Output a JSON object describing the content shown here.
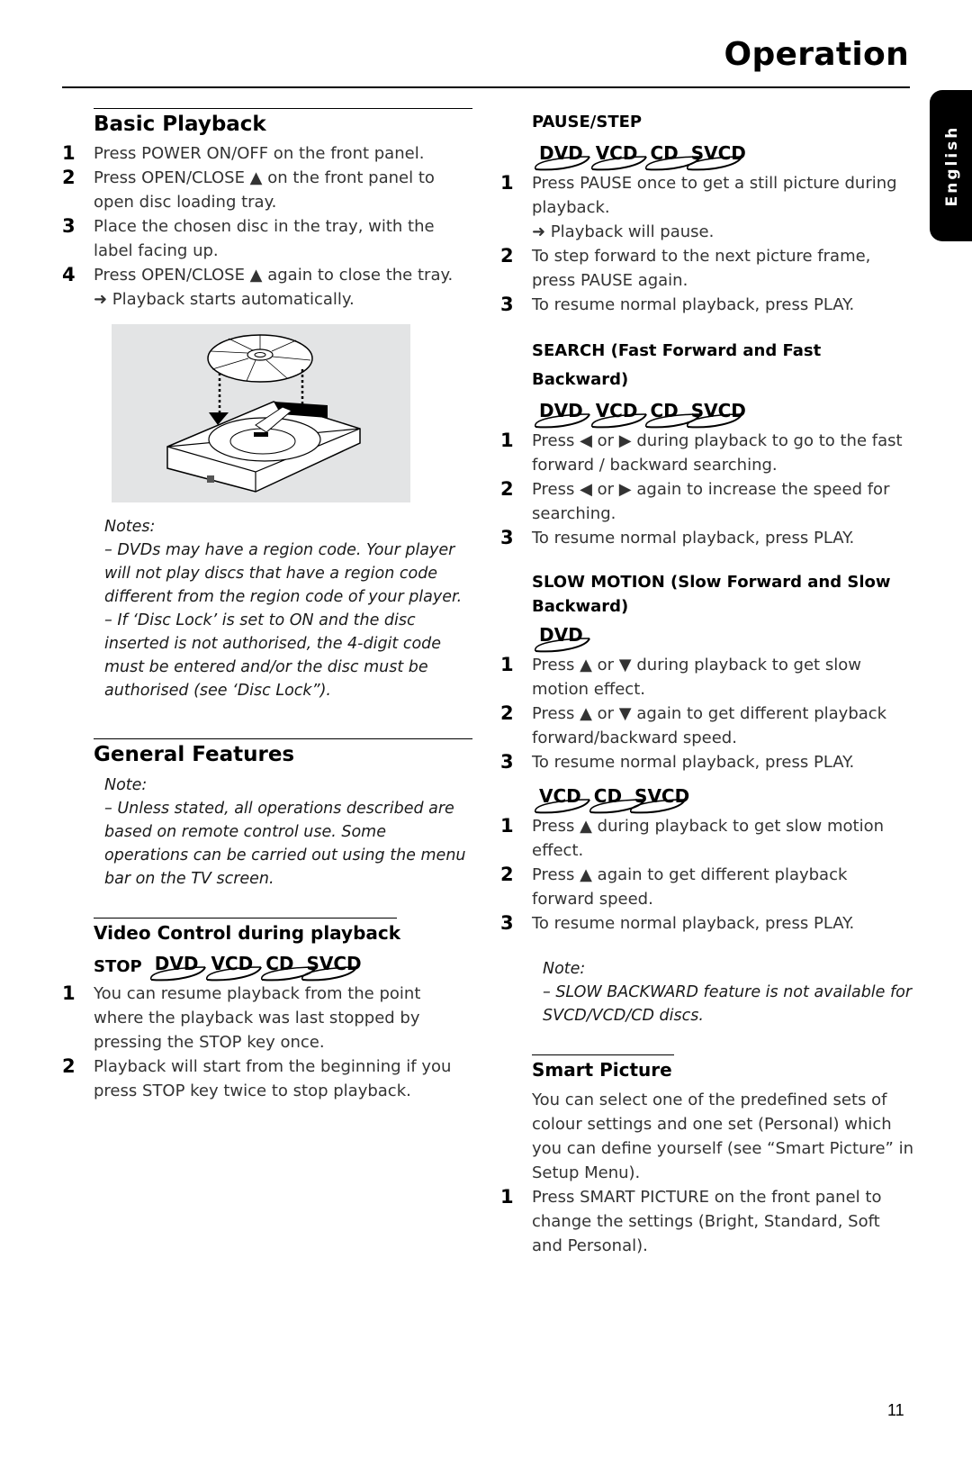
{
  "header": {
    "title": "Operation",
    "language_tab": "English"
  },
  "basic_playback": {
    "heading": "Basic Playback",
    "steps": [
      {
        "num": "1",
        "text": "Press POWER ON/OFF on the front panel."
      },
      {
        "num": "2",
        "text": "Press OPEN/CLOSE ▲ on the front panel to open disc loading tray."
      },
      {
        "num": "3",
        "text": "Place the chosen disc in the tray, with the label facing up."
      },
      {
        "num": "4",
        "text": "Press OPEN/CLOSE ▲ again to close the tray.",
        "result": "➜ Playback starts automatically."
      }
    ],
    "figure_alt": "disc-loading-tray-illustration",
    "notes": {
      "label": "Notes:",
      "items": [
        "–   DVDs may have a region code. Your player will not play discs that have a region code different from the region code of  your player.",
        "–   If ‘Disc Lock’ is set to ON and the disc inserted is not authorised, the 4-digit code must be entered and/or the disc must be authorised (see ‘Disc Lock”)."
      ]
    }
  },
  "general_features": {
    "heading": "General Features",
    "note": {
      "label": "Note:",
      "text": "–   Unless stated, all operations described are based on remote control use. Some operations can be carried out using the menu bar on the TV screen."
    }
  },
  "video_control": {
    "heading": "Video Control during playback",
    "stop": {
      "label": "STOP",
      "discs": [
        "DVD",
        "VCD",
        "CD",
        "SVCD"
      ],
      "steps": [
        {
          "num": "1",
          "text": "You can resume playback from the point where the playback was last stopped by pressing the STOP key once."
        },
        {
          "num": "2",
          "text": "Playback will start from the beginning if you press STOP key twice to stop playback."
        }
      ]
    }
  },
  "pause_step": {
    "label": "PAUSE/STEP",
    "discs": [
      "DVD",
      "VCD",
      "CD",
      "SVCD"
    ],
    "steps": [
      {
        "num": "1",
        "text": "Press PAUSE once to get a still picture during playback.",
        "result": "➜ Playback will pause."
      },
      {
        "num": "2",
        "text": "To step forward to the next picture frame, press PAUSE again."
      },
      {
        "num": "3",
        "text": "To resume normal playback, press PLAY."
      }
    ]
  },
  "search": {
    "label": "SEARCH (Fast Forward and Fast Backward)",
    "discs": [
      "DVD",
      "VCD",
      "CD",
      "SVCD"
    ],
    "steps": [
      {
        "num": "1",
        "text": "Press ◀ or ▶ during playback to go to the fast forward / backward searching."
      },
      {
        "num": "2",
        "text": "Press ◀ or ▶ again to increase the speed for searching."
      },
      {
        "num": "3",
        "text": "To resume normal playback, press PLAY."
      }
    ]
  },
  "slow_motion": {
    "label": "SLOW MOTION (Slow Forward and Slow Backward)",
    "dvd": {
      "discs": [
        "DVD"
      ],
      "steps": [
        {
          "num": "1",
          "text": "Press ▲ or ▼ during playback to get slow motion effect."
        },
        {
          "num": "2",
          "text": "Press ▲ or ▼ again to get different playback forward/backward speed."
        },
        {
          "num": "3",
          "text": "To resume normal playback, press PLAY."
        }
      ]
    },
    "vcd": {
      "discs": [
        "VCD",
        "CD",
        "SVCD"
      ],
      "steps": [
        {
          "num": "1",
          "text": "Press ▲ during playback to get slow motion effect."
        },
        {
          "num": "2",
          "text": "Press ▲ again to get different playback forward speed."
        },
        {
          "num": "3",
          "text": "To resume normal playback, press PLAY."
        }
      ]
    },
    "note": {
      "label": "Note:",
      "text": "–   SLOW BACKWARD feature is not available for SVCD/VCD/CD discs."
    }
  },
  "smart_picture": {
    "heading": "Smart Picture",
    "intro": "You can select one of the predefined sets of colour settings and one set (Personal) which you can define yourself (see “Smart Picture” in Setup Menu).",
    "steps": [
      {
        "num": "1",
        "text": "Press SMART PICTURE on the front panel to change the settings (Bright, Standard, Soft and Personal)."
      }
    ]
  },
  "footer": {
    "page_number": "11"
  }
}
